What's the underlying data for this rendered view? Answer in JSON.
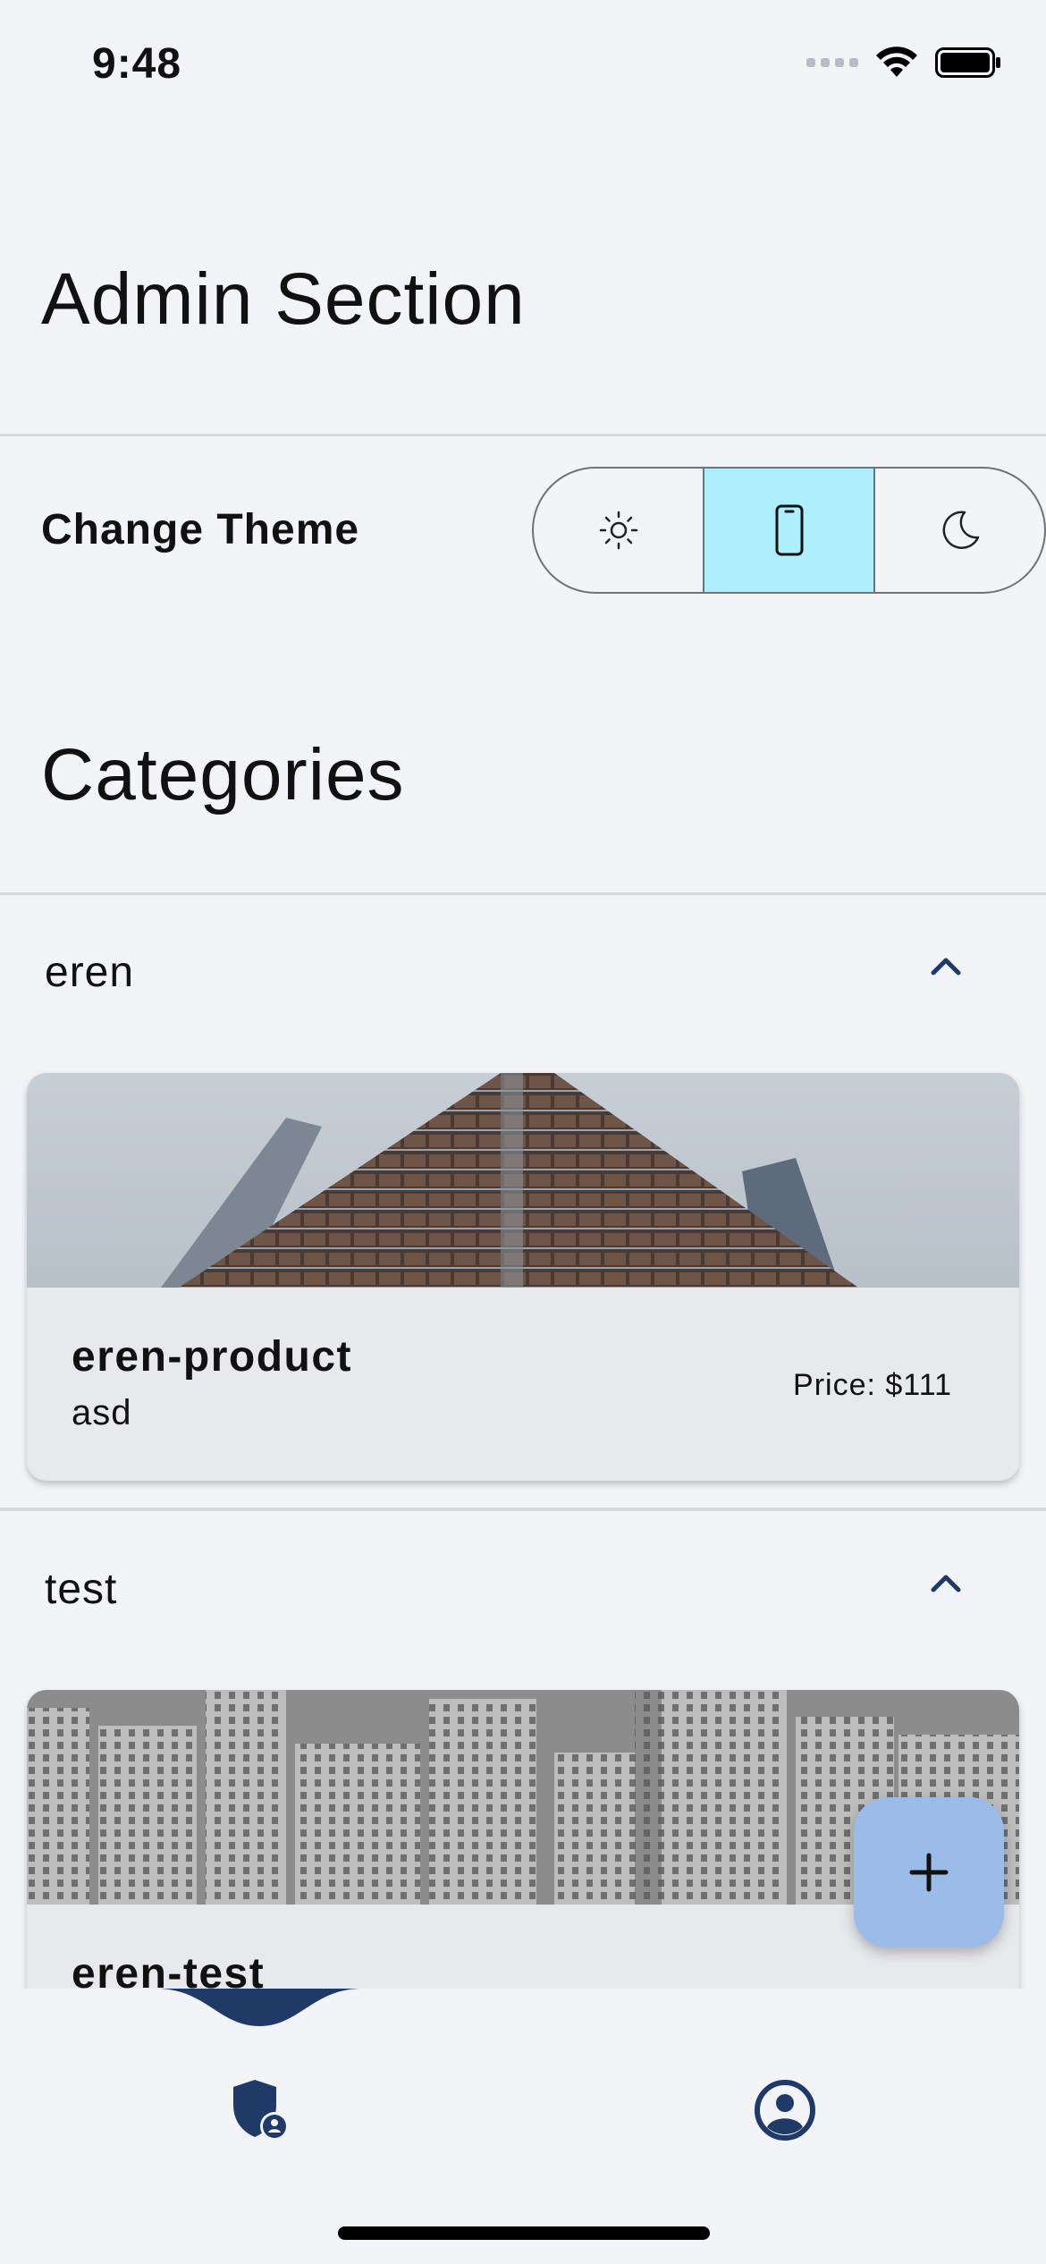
{
  "status_bar": {
    "time": "9:48"
  },
  "page": {
    "title": "Admin Section"
  },
  "theme": {
    "label": "Change Theme",
    "options": [
      {
        "name": "light",
        "icon": "sun-icon"
      },
      {
        "name": "system",
        "icon": "phone-icon",
        "selected": true
      },
      {
        "name": "dark",
        "icon": "moon-icon"
      }
    ],
    "accent": "#aeeffd"
  },
  "categories": {
    "title": "Categories",
    "items": [
      {
        "name": "eren",
        "expanded": true,
        "products": [
          {
            "title": "eren-product",
            "subtitle": "asd",
            "price": "Price: $111"
          }
        ]
      },
      {
        "name": "test",
        "expanded": true,
        "products": [
          {
            "title": "eren-test",
            "subtitle": "",
            "price": ""
          }
        ]
      }
    ]
  },
  "fab": {
    "icon": "plus-icon",
    "color": "#9bbbe8"
  },
  "bottom_nav": {
    "items": [
      {
        "name": "admin",
        "icon": "admin-shield-icon",
        "active": true
      },
      {
        "name": "profile",
        "icon": "account-circle-icon"
      }
    ],
    "accent": "#1f3a66"
  }
}
